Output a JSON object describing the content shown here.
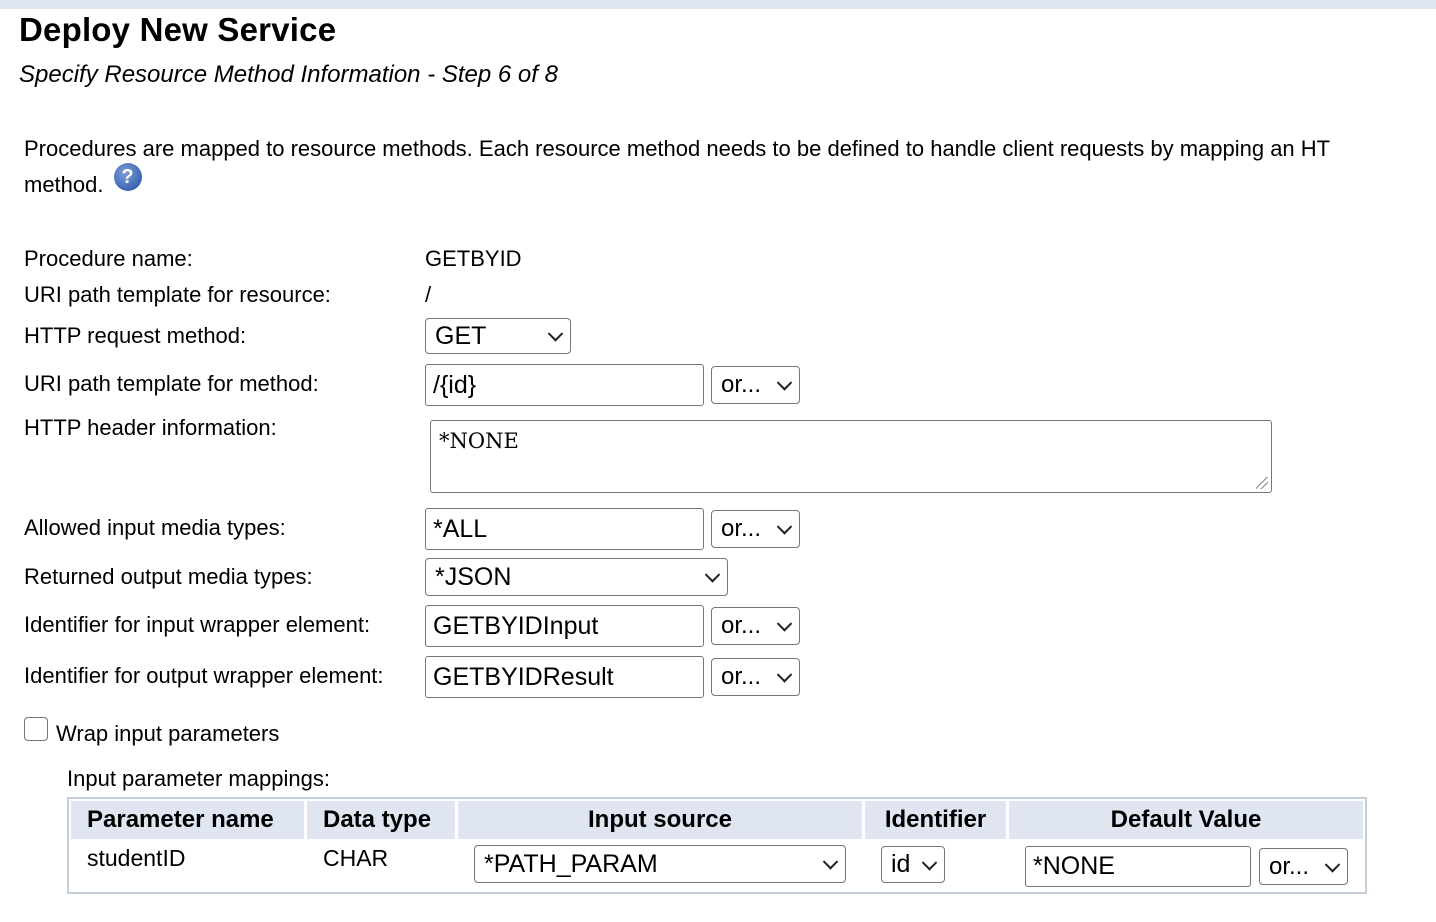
{
  "page": {
    "title": "Deploy New Service",
    "subtitle": "Specify Resource Method Information - Step 6 of 8",
    "intro_text": "Procedures are mapped to resource methods. Each resource method needs to be defined to handle client requests by mapping an HT",
    "intro_text_2": "method.",
    "help_icon": "help-question-icon"
  },
  "form": {
    "procedure_name_label": "Procedure name:",
    "procedure_name_value": "GETBYID",
    "uri_resource_label": "URI path template for resource:",
    "uri_resource_value": "/",
    "http_method_label": "HTTP request method:",
    "http_method_value": "GET",
    "uri_method_label": "URI path template for method:",
    "uri_method_value": "/{id}",
    "uri_method_or": "or...",
    "http_header_label": "HTTP header information:",
    "http_header_value": "*NONE",
    "input_media_label": "Allowed input media types:",
    "input_media_value": "*ALL",
    "input_media_or": "or...",
    "output_media_label": "Returned output media types:",
    "output_media_value": "*JSON",
    "input_wrapper_label": "Identifier for input wrapper element:",
    "input_wrapper_value": "GETBYIDInput",
    "input_wrapper_or": "or...",
    "output_wrapper_label": "Identifier for output wrapper element:",
    "output_wrapper_value": "GETBYIDResult",
    "output_wrapper_or": "or...",
    "wrap_input_label": "Wrap input parameters",
    "wrap_input_checked": false
  },
  "mappings": {
    "title": "Input parameter mappings:",
    "columns": [
      "Parameter name",
      "Data type",
      "Input source",
      "Identifier",
      "Default Value"
    ],
    "rows": [
      {
        "parameter_name": "studentID",
        "data_type": "CHAR",
        "input_source": "*PATH_PARAM",
        "identifier": "id",
        "default_value": "*NONE",
        "default_or": "or..."
      }
    ]
  },
  "colors": {
    "header_strip": "#e1e7f0",
    "table_header": "#dfe6f1",
    "table_border": "#c5cfdb",
    "help_icon": "#3d66b3"
  }
}
